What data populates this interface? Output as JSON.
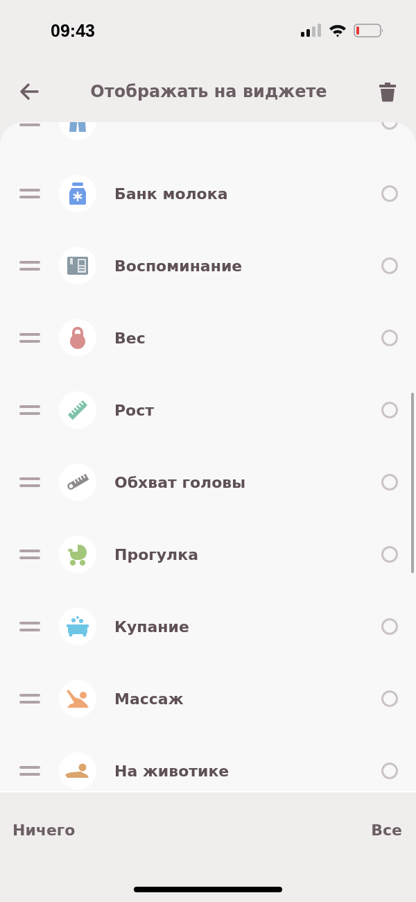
{
  "status_bar": {
    "time": "09:43"
  },
  "header": {
    "title": "Отображать на виджете"
  },
  "items": [
    {
      "kind": "pants",
      "checked": false
    },
    {
      "label": "Банк молока",
      "kind": "jar",
      "checked": false
    },
    {
      "label": "Воспоминание",
      "kind": "album",
      "checked": false
    },
    {
      "label": "Вес",
      "kind": "kettlebell",
      "checked": false
    },
    {
      "label": "Рост",
      "kind": "ruler",
      "checked": false
    },
    {
      "label": "Обхват головы",
      "kind": "tape",
      "checked": false
    },
    {
      "label": "Прогулка",
      "kind": "stroller",
      "checked": false
    },
    {
      "label": "Купание",
      "kind": "bath",
      "checked": false
    },
    {
      "label": "Массаж",
      "kind": "massage",
      "checked": false
    },
    {
      "label": "На животике",
      "kind": "tummy",
      "checked": false
    }
  ],
  "footer": {
    "none_button": "Ничего",
    "all_button": "Все"
  }
}
